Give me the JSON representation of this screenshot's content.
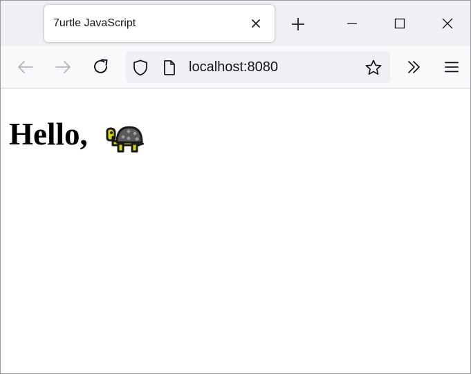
{
  "browser": {
    "tab": {
      "title": "7urtle JavaScript",
      "close_icon": "close-icon"
    },
    "toolbar": {
      "back_icon": "arrow-left-icon",
      "forward_icon": "arrow-right-icon",
      "reload_icon": "reload-icon",
      "address": "localhost:8080",
      "shield_icon": "shield-icon",
      "page_icon": "page-icon",
      "bookmark_icon": "star-icon",
      "overflow_icon": "chevrons-right-icon",
      "menu_icon": "hamburger-menu-icon"
    },
    "window_controls": [
      "minimize-icon",
      "maximize-icon",
      "close-window-icon"
    ]
  },
  "page": {
    "heading": "Hello,",
    "emoji": "turtle-emoji"
  },
  "colors": {
    "tabstrip": "#f0f0f4",
    "navbar": "#f9f9fb",
    "urlbar": "#f0f0f4",
    "turtle_body": "#d4d41a",
    "turtle_outline": "#1a1a1a"
  }
}
